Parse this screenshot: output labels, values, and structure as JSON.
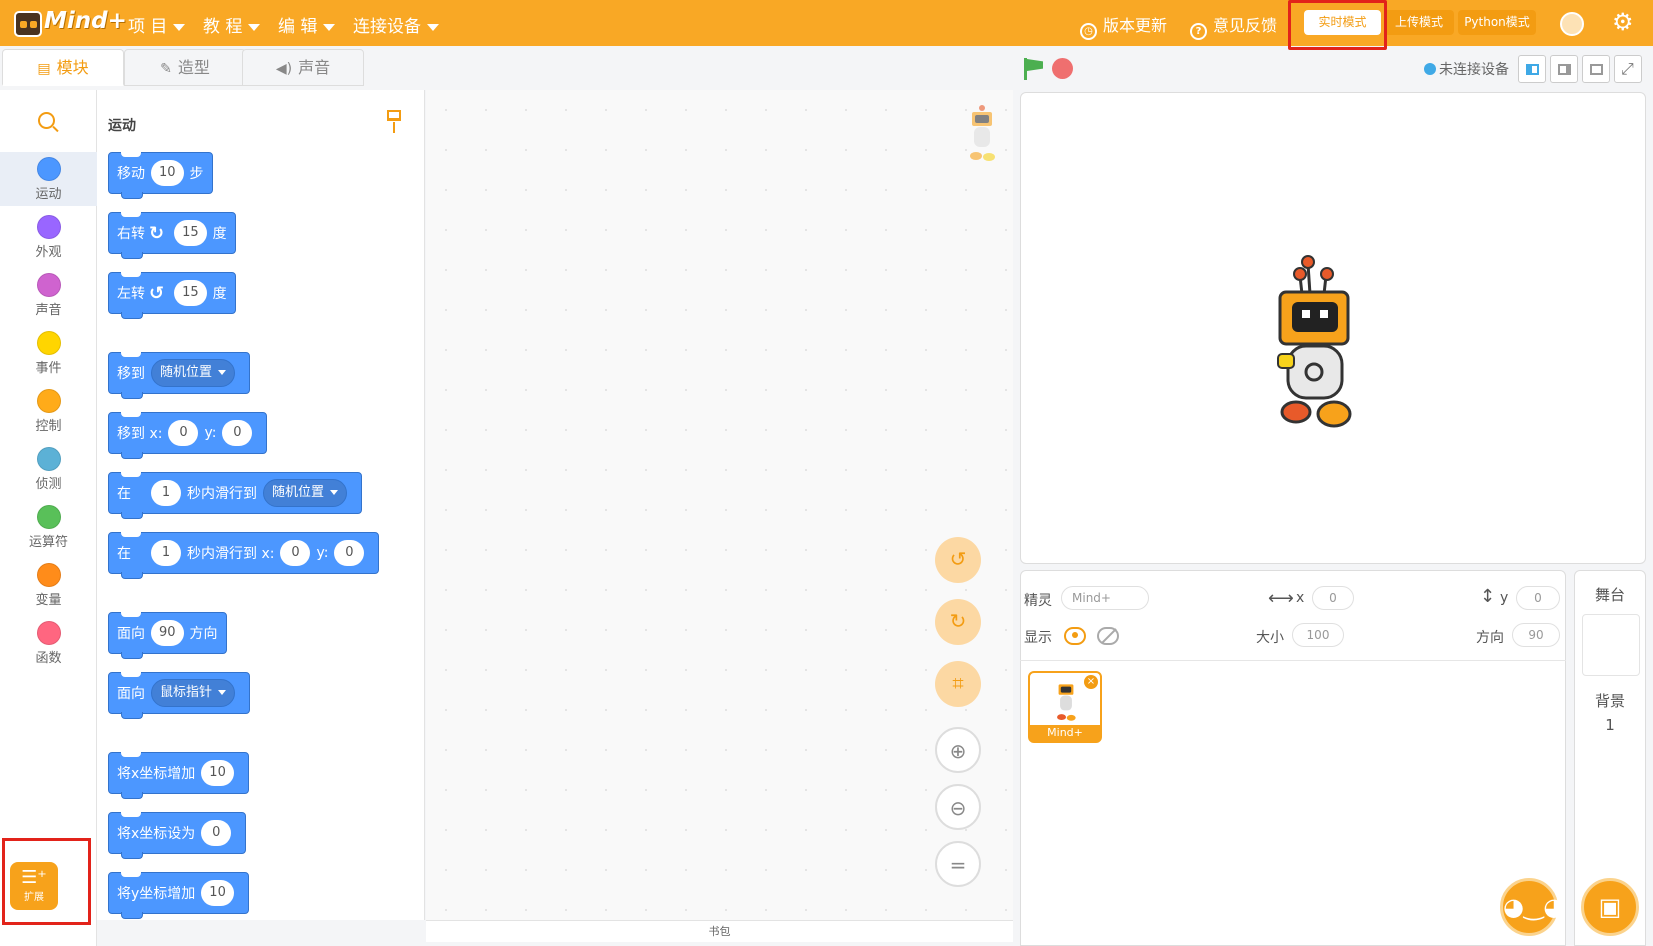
{
  "app": {
    "logo_text": "Mind+"
  },
  "menu": {
    "project": "项 目",
    "tutorial": "教 程",
    "edit": "编 辑",
    "connect": "连接设备"
  },
  "topbar": {
    "update": "版本更新",
    "feedback": "意见反馈"
  },
  "modes": {
    "realtime": "实时模式",
    "upload": "上传模式",
    "python": "Python模式"
  },
  "tabs": {
    "blocks": "模块",
    "costumes": "造型",
    "sounds": "声音"
  },
  "device_status": "未连接设备",
  "categories": [
    {
      "label": "运动",
      "color": "#4c97ff"
    },
    {
      "label": "外观",
      "color": "#9966ff"
    },
    {
      "label": "声音",
      "color": "#cf63cf"
    },
    {
      "label": "事件",
      "color": "#ffd500"
    },
    {
      "label": "控制",
      "color": "#ffab19"
    },
    {
      "label": "侦测",
      "color": "#5cb1d6"
    },
    {
      "label": "运算符",
      "color": "#59c059"
    },
    {
      "label": "变量",
      "color": "#ff8c1a"
    },
    {
      "label": "函数",
      "color": "#ff6680"
    }
  ],
  "extension": {
    "label": "扩展"
  },
  "palette": {
    "title": "运动",
    "blocks": {
      "move": {
        "a": "移动",
        "v": "10",
        "b": "步"
      },
      "turn_right": {
        "a": "右转",
        "v": "15",
        "b": "度"
      },
      "turn_left": {
        "a": "左转",
        "v": "15",
        "b": "度"
      },
      "goto": {
        "a": "移到",
        "d": "随机位置"
      },
      "goto_xy": {
        "a": "移到 x:",
        "x": "0",
        "yl": "y:",
        "y": "0"
      },
      "glide": {
        "a": "在",
        "v": "1",
        "b": "秒内滑行到",
        "d": "随机位置"
      },
      "glide_xy": {
        "a": "在",
        "v": "1",
        "b": "秒内滑行到 x:",
        "x": "0",
        "yl": "y:",
        "y": "0"
      },
      "point_dir": {
        "a": "面向",
        "v": "90",
        "b": "方向"
      },
      "point_towards": {
        "a": "面向",
        "d": "鼠标指针"
      },
      "change_x": {
        "a": "将x坐标增加",
        "v": "10"
      },
      "set_x": {
        "a": "将x坐标设为",
        "v": "0"
      },
      "change_y": {
        "a": "将y坐标增加",
        "v": "10"
      }
    }
  },
  "backpack": "书包",
  "sprite_info": {
    "sprite_label": "精灵",
    "sprite_name": "Mind+",
    "x_label": "x",
    "x": "0",
    "y_label": "y",
    "y": "0",
    "show_label": "显示",
    "size_label": "大小",
    "size": "100",
    "dir_label": "方向",
    "direction": "90",
    "thumb_label": "Mind+"
  },
  "stage_panel": {
    "title": "舞台",
    "backdrop_label": "背景",
    "backdrop_count": "1"
  }
}
